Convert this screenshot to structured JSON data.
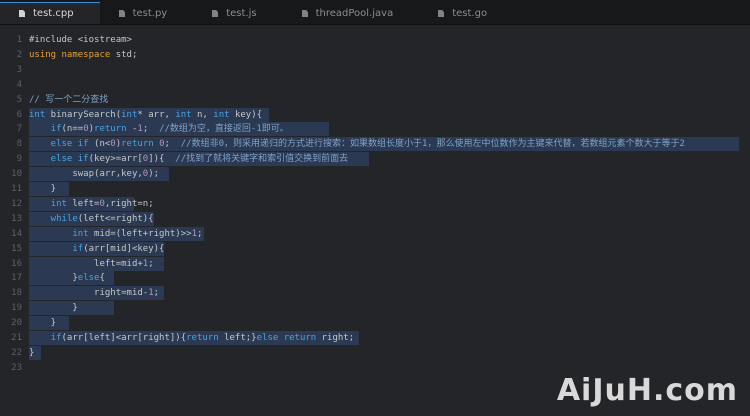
{
  "tabs": [
    {
      "label": "test.cpp",
      "active": true
    },
    {
      "label": "test.py",
      "active": false
    },
    {
      "label": "test.js",
      "active": false
    },
    {
      "label": "threadPool.java",
      "active": false
    },
    {
      "label": "test.go",
      "active": false
    }
  ],
  "lines": [
    {
      "n": "1",
      "segs": [
        {
          "t": "#include <iostream>",
          "c": ""
        }
      ]
    },
    {
      "n": "2",
      "segs": [
        {
          "t": "using namespace",
          "c": "kw2"
        },
        {
          "t": " std;",
          "c": ""
        }
      ]
    },
    {
      "n": "3",
      "segs": []
    },
    {
      "n": "4",
      "segs": []
    },
    {
      "n": "5",
      "segs": [
        {
          "t": "// 写一个二分查找",
          "c": "cm"
        }
      ]
    },
    {
      "n": "6",
      "segs": [
        {
          "t": "int",
          "c": "kw"
        },
        {
          "t": " binarySearch(",
          "c": ""
        },
        {
          "t": "int",
          "c": "kw"
        },
        {
          "t": "* arr, ",
          "c": ""
        },
        {
          "t": "int",
          "c": "kw"
        },
        {
          "t": " n, ",
          "c": ""
        },
        {
          "t": "int",
          "c": "kw"
        },
        {
          "t": " key){",
          "c": ""
        }
      ]
    },
    {
      "n": "7",
      "segs": [
        {
          "t": "    if",
          "c": "kw"
        },
        {
          "t": "(n==",
          "c": ""
        },
        {
          "t": "0",
          "c": "num"
        },
        {
          "t": ")",
          "c": ""
        },
        {
          "t": "return",
          "c": "kw"
        },
        {
          "t": " -",
          "c": ""
        },
        {
          "t": "1",
          "c": "num"
        },
        {
          "t": ";  ",
          "c": ""
        },
        {
          "t": "//数组为空，直接返回-1即可。",
          "c": "cm"
        }
      ]
    },
    {
      "n": "8",
      "segs": [
        {
          "t": "    else if",
          "c": "kw"
        },
        {
          "t": " (n<",
          "c": ""
        },
        {
          "t": "0",
          "c": "num"
        },
        {
          "t": ")",
          "c": ""
        },
        {
          "t": "return",
          "c": "kw"
        },
        {
          "t": " ",
          "c": ""
        },
        {
          "t": "0",
          "c": "num"
        },
        {
          "t": ";  ",
          "c": ""
        },
        {
          "t": "//数组非0，则采用递归的方式进行搜索：如果数组长度小于1，那么使用左中位数作为主键来代替，若数组元素个数大于等于2",
          "c": "cm"
        }
      ]
    },
    {
      "n": "9",
      "segs": [
        {
          "t": "    else if",
          "c": "kw"
        },
        {
          "t": "(key>=arr[",
          "c": ""
        },
        {
          "t": "0",
          "c": "num"
        },
        {
          "t": "]){  ",
          "c": ""
        },
        {
          "t": "//找到了就将关键字和索引值交换到前面去",
          "c": "cm"
        }
      ]
    },
    {
      "n": "10",
      "segs": [
        {
          "t": "        swap(arr,key,",
          "c": ""
        },
        {
          "t": "0",
          "c": "num"
        },
        {
          "t": ");",
          "c": ""
        }
      ]
    },
    {
      "n": "11",
      "segs": [
        {
          "t": "    }",
          "c": ""
        }
      ]
    },
    {
      "n": "12",
      "segs": [
        {
          "t": "    int",
          "c": "kw"
        },
        {
          "t": " left=",
          "c": ""
        },
        {
          "t": "0",
          "c": "num"
        },
        {
          "t": ",right=n;",
          "c": ""
        }
      ]
    },
    {
      "n": "13",
      "segs": [
        {
          "t": "    while",
          "c": "kw"
        },
        {
          "t": "(left<=right){",
          "c": ""
        }
      ]
    },
    {
      "n": "14",
      "segs": [
        {
          "t": "        int",
          "c": "kw"
        },
        {
          "t": " mid=(left+right)>>",
          "c": ""
        },
        {
          "t": "1",
          "c": "num"
        },
        {
          "t": ";",
          "c": ""
        }
      ]
    },
    {
      "n": "15",
      "segs": [
        {
          "t": "        if",
          "c": "kw"
        },
        {
          "t": "(arr[mid]<key){",
          "c": ""
        }
      ]
    },
    {
      "n": "16",
      "segs": [
        {
          "t": "            left=mid+",
          "c": ""
        },
        {
          "t": "1",
          "c": "num"
        },
        {
          "t": ";",
          "c": ""
        }
      ]
    },
    {
      "n": "17",
      "segs": [
        {
          "t": "        }",
          "c": ""
        },
        {
          "t": "else",
          "c": "kw"
        },
        {
          "t": "{",
          "c": ""
        }
      ]
    },
    {
      "n": "18",
      "segs": [
        {
          "t": "            right=mid-",
          "c": ""
        },
        {
          "t": "1",
          "c": "num"
        },
        {
          "t": ";",
          "c": ""
        }
      ]
    },
    {
      "n": "19",
      "segs": [
        {
          "t": "        }",
          "c": ""
        }
      ]
    },
    {
      "n": "20",
      "segs": [
        {
          "t": "    }",
          "c": ""
        }
      ]
    },
    {
      "n": "21",
      "segs": [
        {
          "t": "    if",
          "c": "kw"
        },
        {
          "t": "(arr[left]<arr[right]){",
          "c": ""
        },
        {
          "t": "return",
          "c": "kw"
        },
        {
          "t": " left;}",
          "c": ""
        },
        {
          "t": "else",
          "c": "kw"
        },
        {
          "t": " ",
          "c": ""
        },
        {
          "t": "return",
          "c": "kw"
        },
        {
          "t": " right;",
          "c": ""
        }
      ]
    },
    {
      "n": "22",
      "segs": [
        {
          "t": "}",
          "c": ""
        }
      ]
    },
    {
      "n": "23",
      "segs": []
    }
  ],
  "watermark": "AiJuH.com",
  "colors": {
    "background": "#232528",
    "selection": "#2c3a55",
    "keyword": "#4aa3df",
    "comment": "#7fa3c9"
  }
}
